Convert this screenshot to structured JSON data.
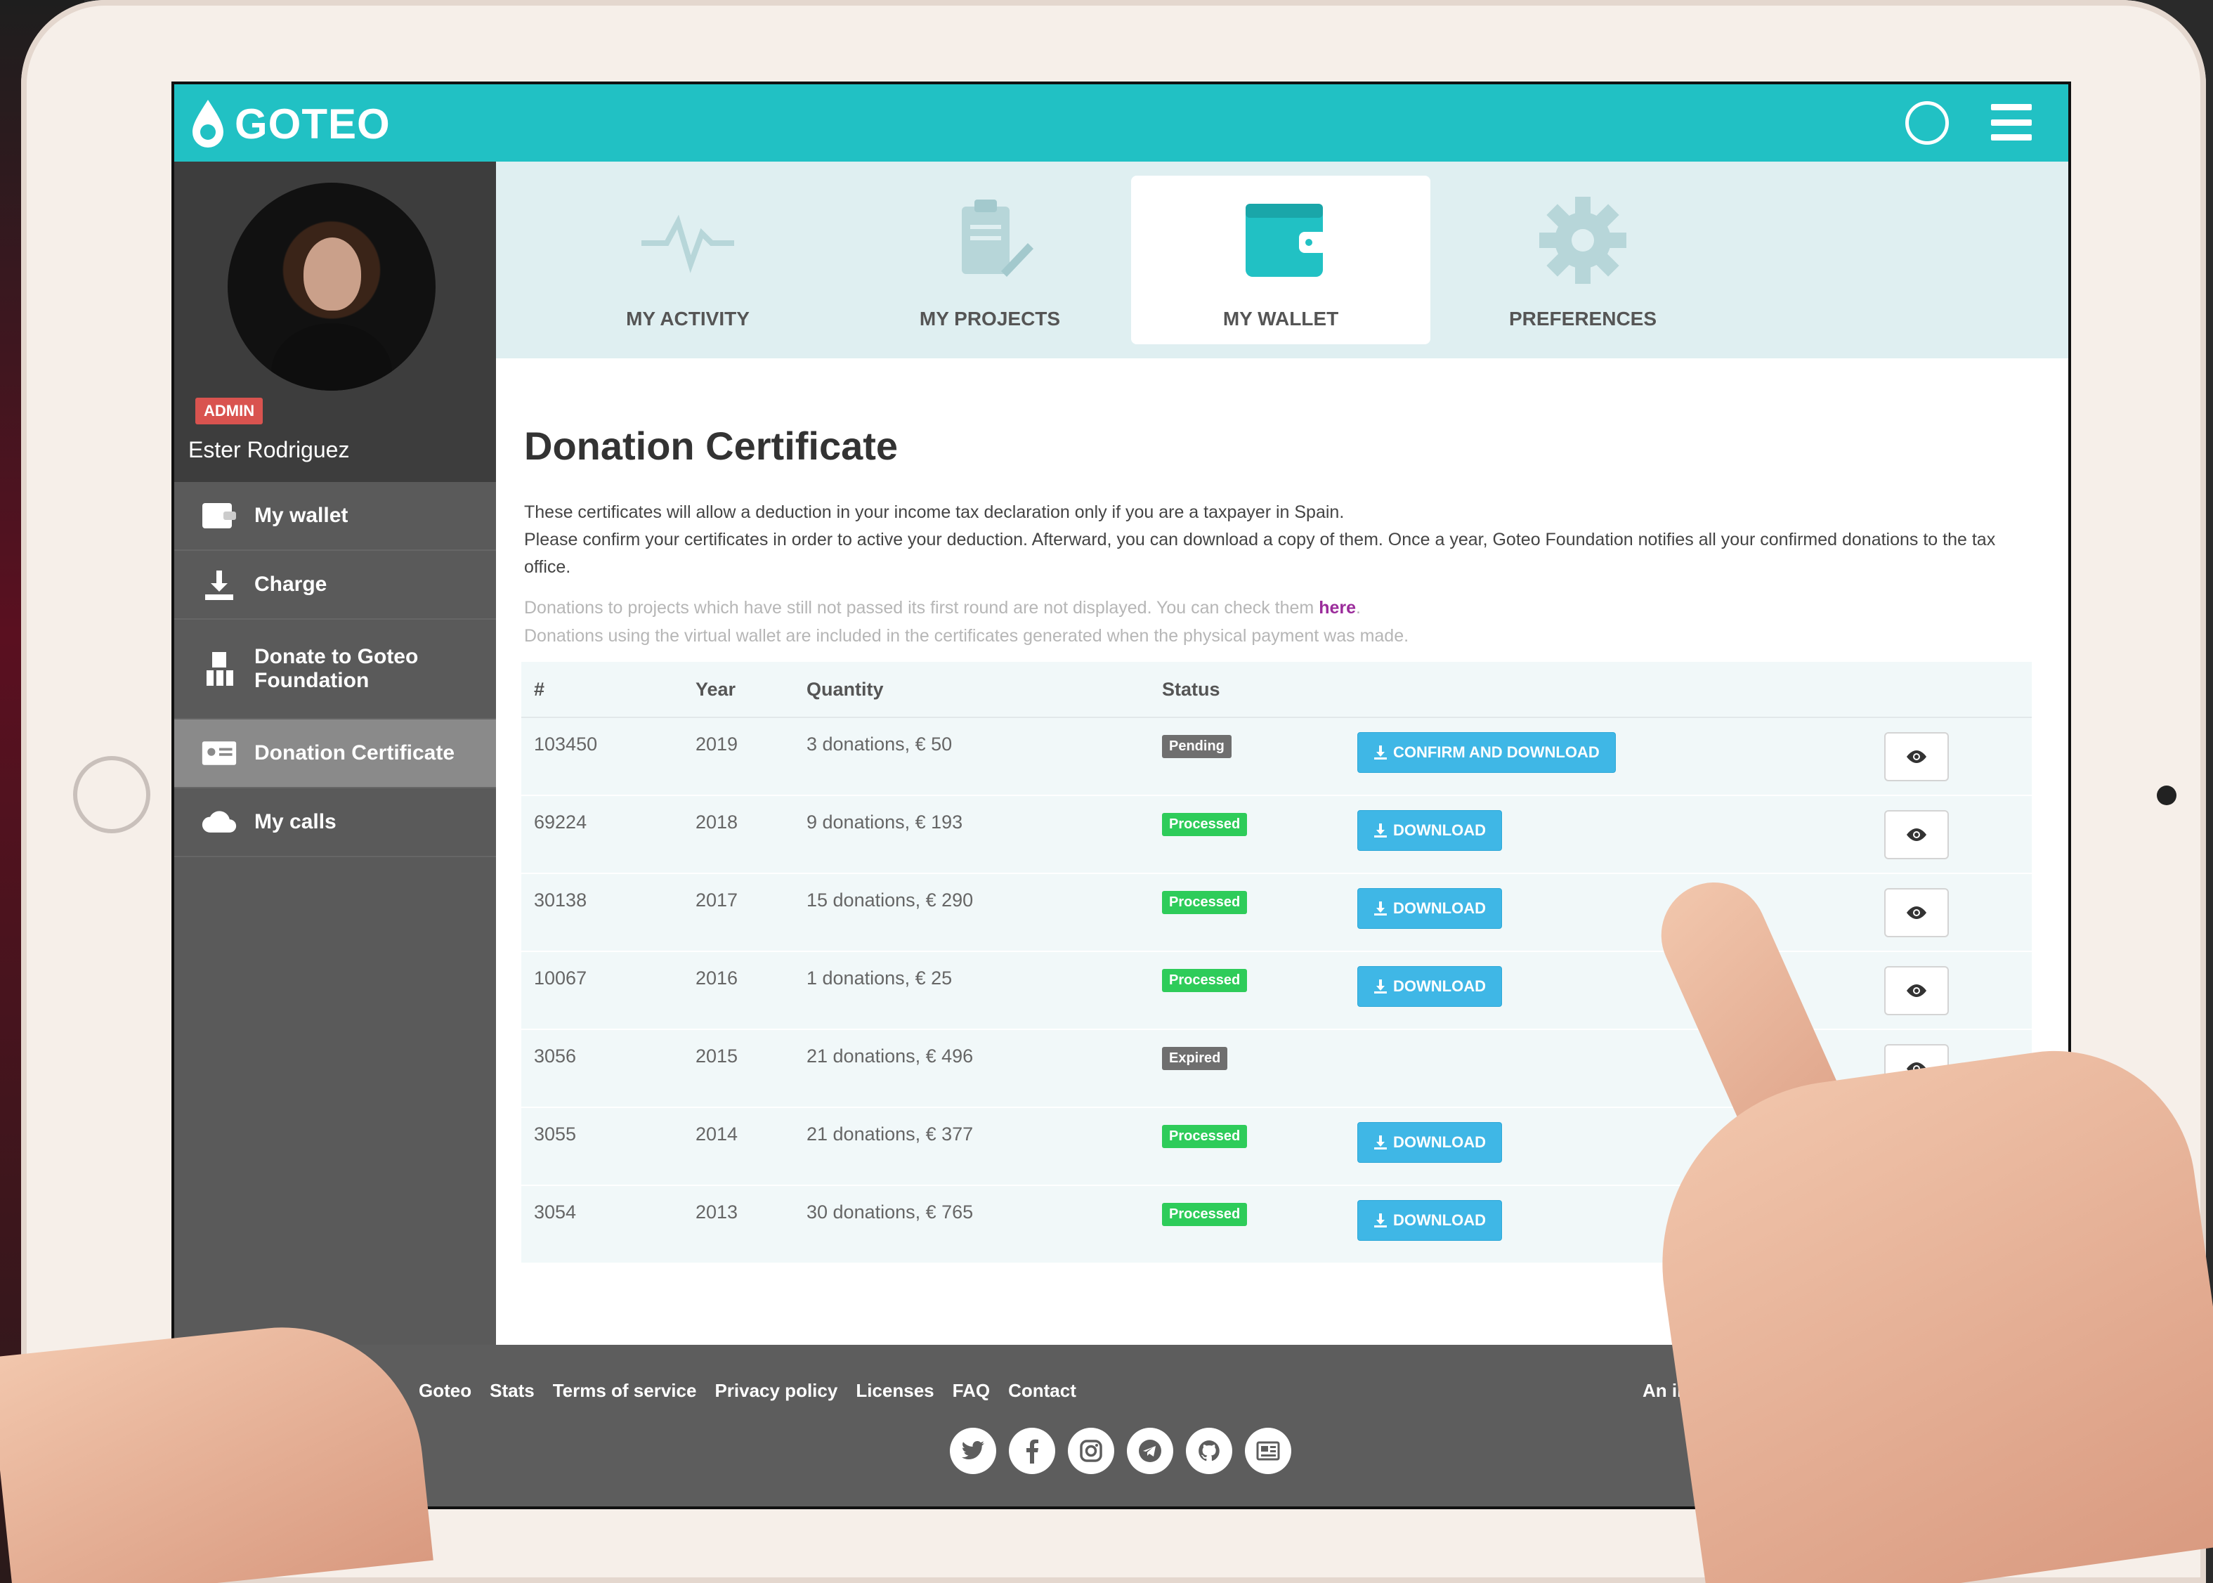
{
  "brand": {
    "name": "GOTEO",
    "accent": "#21c1c4"
  },
  "header": {
    "search_icon": "search-icon",
    "menu_icon": "hamburger-menu-icon"
  },
  "profile": {
    "badge": "ADMIN",
    "name": "Ester Rodriguez"
  },
  "sidebar": {
    "items": [
      {
        "label": "My wallet",
        "icon": "wallet-icon"
      },
      {
        "label": "Charge",
        "icon": "download-icon"
      },
      {
        "label": "Donate to Goteo Foundation",
        "icon": "donate-icon"
      },
      {
        "label": "Donation Certificate",
        "icon": "certificate-icon",
        "active": true
      },
      {
        "label": "My calls",
        "icon": "cloud-icon"
      }
    ]
  },
  "tabs": [
    {
      "label": "MY ACTIVITY",
      "icon": "activity-icon"
    },
    {
      "label": "MY PROJECTS",
      "icon": "clipboard-icon"
    },
    {
      "label": "MY WALLET",
      "icon": "wallet-icon",
      "active": true
    },
    {
      "label": "PREFERENCES",
      "icon": "gear-icon"
    }
  ],
  "page": {
    "title": "Donation Certificate",
    "desc1": "These certificates will allow a deduction in your income tax declaration only if you are a taxpayer in Spain.",
    "desc2": "Please confirm your certificates in order to active your deduction. Afterward, you can download a copy of them. Once a year, Goteo Foundation notifies all your confirmed donations to the tax office.",
    "note1_prefix": "Donations to projects which have still not passed its first round are not displayed. You can check them ",
    "note1_link": "here",
    "note1_suffix": ".",
    "note2": "Donations using the virtual wallet are included in the certificates generated when the physical payment was made."
  },
  "table": {
    "headers": {
      "num": "#",
      "year": "Year",
      "quantity": "Quantity",
      "status": "Status"
    },
    "rows": [
      {
        "num": "103450",
        "year": "2019",
        "quantity": "3 donations, € 50",
        "status": "Pending",
        "action": "CONFIRM AND DOWNLOAD"
      },
      {
        "num": "69224",
        "year": "2018",
        "quantity": "9 donations, € 193",
        "status": "Processed",
        "action": "DOWNLOAD"
      },
      {
        "num": "30138",
        "year": "2017",
        "quantity": "15 donations, € 290",
        "status": "Processed",
        "action": "DOWNLOAD"
      },
      {
        "num": "10067",
        "year": "2016",
        "quantity": "1 donations, € 25",
        "status": "Processed",
        "action": "DOWNLOAD"
      },
      {
        "num": "3056",
        "year": "2015",
        "quantity": "21 donations, € 496",
        "status": "Expired",
        "action": ""
      },
      {
        "num": "3055",
        "year": "2014",
        "quantity": "21 donations, € 377",
        "status": "Processed",
        "action": "DOWNLOAD"
      },
      {
        "num": "3054",
        "year": "2013",
        "quantity": "30 donations, € 765",
        "status": "Processed",
        "action": "DOWNLOAD"
      }
    ]
  },
  "footer": {
    "links": [
      "Goteo",
      "Stats",
      "Terms of service",
      "Privacy policy",
      "Licenses",
      "FAQ",
      "Contact"
    ],
    "initiative": "An initiative",
    "social": [
      "twitter-icon",
      "facebook-icon",
      "instagram-icon",
      "telegram-icon",
      "github-icon",
      "newsletter-icon"
    ]
  }
}
